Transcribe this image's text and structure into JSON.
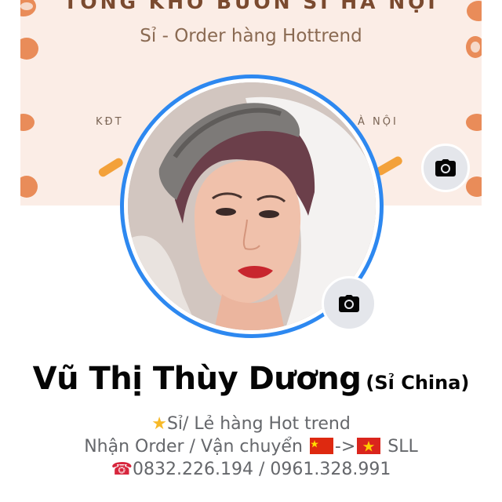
{
  "cover": {
    "title": "TỔNG KHO BUÔN SỈ HÀ NỘI",
    "subtitle": "Sỉ - Order hàng Hottrend",
    "address_left": "KĐT",
    "address_right": "À NỘI"
  },
  "profile": {
    "name": "Vũ Thị Thùy Dương",
    "alternate_name": "(Sỉ China)",
    "bio": {
      "line1_icon": "star-icon",
      "line1_text": "Sỉ/ Lẻ hàng Hot trend",
      "line2_text": "Nhận Order / Vận chuyển",
      "line2_arrow": "->",
      "line2_suffix": "SLL",
      "line3_icon": "telephone-icon",
      "line3_text": "0832.226.194 / 0961.328.991"
    }
  },
  "buttons": {
    "cover_camera_icon": "camera-icon",
    "avatar_camera_icon": "camera-icon"
  },
  "colors": {
    "ring": "#2d88f0",
    "cover_bg": "#fbede6",
    "name": "#050505",
    "bio": "#65676b",
    "camera_button_bg": "#e4e6eb"
  }
}
